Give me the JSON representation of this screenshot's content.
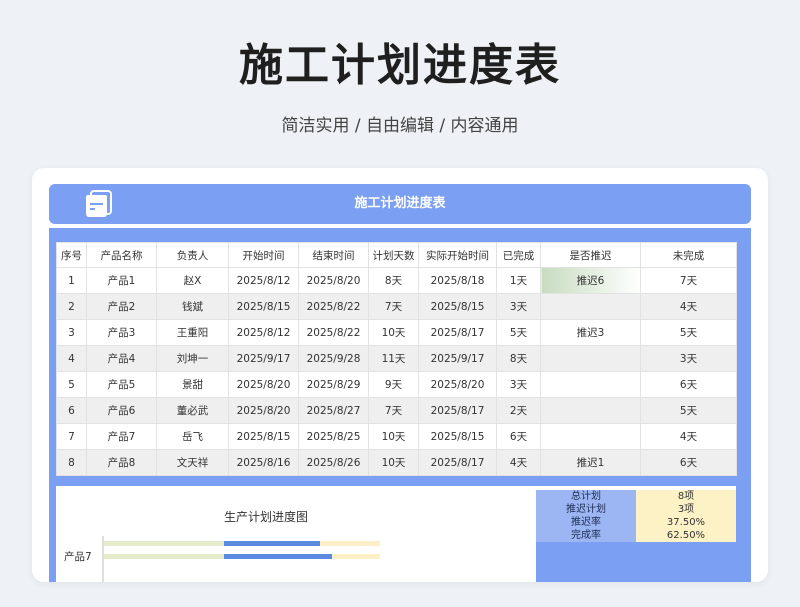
{
  "title": "施工计划进度表",
  "subtitle": "简洁实用 / 自由编辑 / 内容通用",
  "sheet": {
    "header_title": "施工计划进度表",
    "columns": [
      "序号",
      "产品名称",
      "负责人",
      "开始时间",
      "结束时间",
      "计划天数",
      "实际开始时间",
      "已完成",
      "是否推迟",
      "未完成"
    ],
    "rows": [
      [
        "1",
        "产品1",
        "赵X",
        "2025/8/12",
        "2025/8/20",
        "8天",
        "2025/8/18",
        "1天",
        "推迟6",
        "7天"
      ],
      [
        "2",
        "产品2",
        "钱斌",
        "2025/8/15",
        "2025/8/22",
        "7天",
        "2025/8/15",
        "3天",
        "",
        "4天"
      ],
      [
        "3",
        "产品3",
        "王重阳",
        "2025/8/12",
        "2025/8/22",
        "10天",
        "2025/8/17",
        "5天",
        "推迟3",
        "5天"
      ],
      [
        "4",
        "产品4",
        "刘坤一",
        "2025/9/17",
        "2025/9/28",
        "11天",
        "2025/9/17",
        "8天",
        "",
        "3天"
      ],
      [
        "5",
        "产品5",
        "景甜",
        "2025/8/20",
        "2025/8/29",
        "9天",
        "2025/8/20",
        "3天",
        "",
        "6天"
      ],
      [
        "6",
        "产品6",
        "董必武",
        "2025/8/20",
        "2025/8/27",
        "7天",
        "2025/8/17",
        "2天",
        "",
        "5天"
      ],
      [
        "7",
        "产品7",
        "岳飞",
        "2025/8/15",
        "2025/8/25",
        "10天",
        "2025/8/15",
        "6天",
        "",
        "4天"
      ],
      [
        "8",
        "产品8",
        "文天祥",
        "2025/8/16",
        "2025/8/26",
        "10天",
        "2025/8/17",
        "4天",
        "推迟1",
        "6天"
      ]
    ],
    "summary": [
      {
        "label": "总计划",
        "value": "8项"
      },
      {
        "label": "推迟计划",
        "value": "3项"
      },
      {
        "label": "推迟率",
        "value": "37.50%"
      },
      {
        "label": "完成率",
        "value": "62.50%"
      }
    ]
  },
  "chart_data": {
    "type": "bar",
    "title": "生产计划进度图",
    "categories": [
      "产品7"
    ],
    "colors": {
      "delay": "#e5ecc9",
      "done": "#5b8be0",
      "remaining": "#fdf0c8"
    },
    "bars": [
      {
        "delay": 0.3,
        "done": 0.24,
        "remaining": 0.15
      },
      {
        "delay": 0.3,
        "done": 0.27,
        "remaining": 0.12
      }
    ]
  }
}
